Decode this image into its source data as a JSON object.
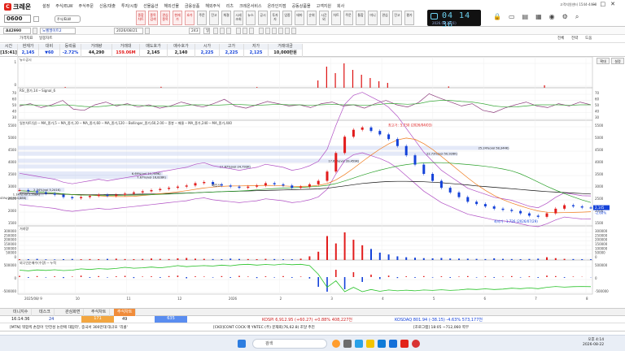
{
  "app": {
    "name": "크레온",
    "contact": "고객지원센터 1544-4488"
  },
  "menu": [
    "설정",
    "주식/ELW",
    "주식주문",
    "신용/대출",
    "투자/시황",
    "선물옵션",
    "해외선물",
    "금융상품",
    "해외주식",
    "리츠",
    "크레온서비스",
    "온라인지점",
    "공동상품몰",
    "고객지원",
    "회사"
  ],
  "toolbar_buttons": [
    "종합\n차트",
    "종목\n검색",
    "관심\n종목",
    "현재\n가",
    "호가",
    "주문",
    "잔고",
    "체결",
    "시세\n조회",
    "뉴스",
    "공시",
    "투자\n자",
    "업종",
    "테마",
    "순위",
    "시간\n외",
    "차트",
    "주문",
    "통합",
    "미니",
    "관심",
    "잔고",
    "평가"
  ],
  "clock": {
    "time": "04 14 36",
    "date": "2026.08.22(토)"
  },
  "stock": {
    "code": "0600",
    "code2": "A42990",
    "market_select": "주식/ELW",
    "name": "노벨엘이트2",
    "date": "2026/08/21",
    "count": "243",
    "period": "일",
    "chart_type": "일봉차트"
  },
  "tool3": {
    "tabs": [
      "가격지표",
      "일봉차트"
    ],
    "right": [
      "전체",
      "전략",
      "도움"
    ],
    "side": [
      "확대",
      "설정"
    ]
  },
  "pricehead": [
    {
      "label": "시간",
      "value": "[15:41]",
      "cls": ""
    },
    {
      "label": "현재가",
      "value": "2,145",
      "cls": "dn"
    },
    {
      "label": "대비",
      "value": "▼60",
      "cls": "dn"
    },
    {
      "label": "등락률",
      "value": "-2.72%",
      "cls": "dn"
    },
    {
      "label": "거래량",
      "value": "44,290",
      "cls": ""
    },
    {
      "label": "거래대",
      "value": "159.06M",
      "cls": "up"
    },
    {
      "label": "매도호가",
      "value": "2,145",
      "cls": ""
    },
    {
      "label": "매수호가",
      "value": "2,140",
      "cls": ""
    },
    {
      "label": "시가",
      "value": "2,225",
      "cls": "dn"
    },
    {
      "label": "고가",
      "value": "2,225",
      "cls": "dn"
    },
    {
      "label": "저가",
      "value": "2,125",
      "cls": "dn"
    },
    {
      "label": "거래대금",
      "value": "10,000만원",
      "cls": ""
    }
  ],
  "panels": {
    "p1": {
      "label": "뉴스공시",
      "yticks": [
        "1",
        "0"
      ]
    },
    "p2": {
      "label": "RSI_종가,14 ─ Signal_6",
      "yticks": [
        "70",
        "60",
        "50",
        "40",
        "30"
      ],
      "rticks": [
        "70",
        "60",
        "50",
        "40",
        "30"
      ]
    },
    "p3": {
      "label": "일봉차트(일) ─ MA_종가,5 ─ MA_종가,20 ─ MA_종가,60 ─ MA_종가,120 ─ Bollinger_종가,60,2.00 ─ 종봉 ─ 매물 ─ MA_종가,240 ─ MA_종가,480",
      "yticks": [
        "5500",
        "5000",
        "4500",
        "4000",
        "3500",
        "3000",
        "2500",
        "2000",
        "1500"
      ],
      "rticks": [
        "5500",
        "5000",
        "4500",
        "4000",
        "3500",
        "3000",
        "2500",
        "2000",
        "1500"
      ],
      "current": "2,145",
      "change": "-2.60%",
      "high_label": "최고가 : 5,730 (2026/04/03)",
      "low_label": "최저가 : 1,726 (2026/07/29)",
      "vp": [
        "25.24%(vol 58,344K)",
        "22.73%(vol 50,926K)",
        "17.61%(vol 39,459K)",
        "11.87%(vol 24,793K)",
        "6.69%(vol 14,769K)",
        "7.67%(vol 16,828K)",
        "2.34%(vol 5,241K)",
        "1.14%(vol 2,558K)",
        "0.43%(vol 954,886)"
      ],
      "annot": "매입선"
    },
    "p4": {
      "label": "거래량",
      "yticks": [
        "300000",
        "250000",
        "200000",
        "150000",
        "100000",
        "50000",
        "0"
      ],
      "rticks": [
        "300000",
        "250000",
        "200000",
        "150000",
        "100000",
        "50000",
        "0"
      ]
    },
    "p5": {
      "label": "외국인순매수(수량) ─ 누적",
      "yticks": [
        "500000",
        "0",
        "-500000"
      ],
      "rticks": [
        "500000",
        "0",
        "-500000"
      ]
    }
  },
  "xaxis": [
    "2025/08/ 9",
    "10",
    "11",
    "12",
    "2026",
    "2",
    "3",
    "4",
    "5",
    "6",
    "7",
    "8"
  ],
  "tabs": [
    "미니지수",
    "데스크",
    "관심화면",
    "주식차트",
    "주식차트"
  ],
  "ticker": {
    "time": "16:14:36",
    "c1": "24",
    "c2": "171",
    "c3": "49",
    "c4": "635",
    "kospi": "KOSPI 6,912.95 (+60.27) +0.88% 408,227천",
    "kosdaq": "KOSDAQ 801.94 (-38.15) -4.63% 573,177천"
  },
  "news": {
    "left": "[MTN] 뭐함씩 손잡아 '안전성 논란에 대답라', 중국서 300만대 대규모 '리콜'",
    "right": "[CKO]CONT COCK 매 YNTEC (주) 문재회(76,62.8) 조달 추진",
    "far": "[조로그램] 18:05 ~712,060 쪽부"
  },
  "taskbar": {
    "search": "검색",
    "time": "오후 4:14",
    "date": "2026-08-22"
  },
  "colors": {
    "up": "#e21c1c",
    "down": "#1442d9",
    "accent": "#f08c3a",
    "bg_upper": "#cdd7f3"
  },
  "chart_data": [
    {
      "type": "line",
      "title": "RSI",
      "series": [
        {
          "name": "RSI_종가,14",
          "values": [
            48,
            52,
            45,
            50,
            58,
            42,
            40,
            50,
            55,
            48,
            52,
            46,
            50,
            44,
            48,
            55,
            50,
            46,
            52,
            60,
            48,
            44,
            50,
            56,
            52,
            48,
            50,
            45,
            52,
            55,
            48,
            50,
            44,
            52,
            58,
            50,
            46,
            54,
            70,
            62,
            55,
            48,
            52,
            40,
            36,
            44,
            50,
            55,
            48,
            45,
            52,
            48,
            55,
            50
          ]
        },
        {
          "name": "Signal_6",
          "values": [
            50,
            50,
            49,
            48,
            50,
            49,
            47,
            46,
            48,
            50,
            50,
            49,
            48,
            48,
            47,
            48,
            50,
            50,
            49,
            50,
            51,
            50,
            49,
            50,
            51,
            50,
            50,
            49,
            50,
            51,
            50,
            50,
            49,
            50,
            52,
            52,
            51,
            52,
            56,
            58,
            58,
            56,
            55,
            52,
            48,
            46,
            46,
            48,
            50,
            50,
            50,
            49,
            50,
            50
          ]
        }
      ]
    },
    {
      "type": "line",
      "title": "주가",
      "ylim": [
        1500,
        5700
      ],
      "series": [
        {
          "name": "종가",
          "values": [
            2900,
            2850,
            2800,
            2750,
            2700,
            2600,
            2550,
            2600,
            2650,
            2700,
            2650,
            2700,
            2750,
            2800,
            2850,
            2900,
            2950,
            3000,
            3050,
            3100,
            3200,
            3250,
            3150,
            3100,
            3050,
            3000,
            3050,
            3100,
            3200,
            3150,
            3100,
            3000,
            3050,
            3150,
            3300,
            3700,
            4500,
            5200,
            5500,
            5600,
            5450,
            5300,
            5100,
            4800,
            4400,
            4000,
            3600,
            3300,
            3000,
            2800,
            2600,
            2400,
            2300,
            2200,
            2100,
            2050,
            2000,
            1900,
            1800,
            1750,
            1900,
            2100,
            2250,
            2200,
            2150,
            2145
          ]
        },
        {
          "name": "MA_종가,120",
          "values": [
            2800,
            2790,
            2780,
            2770,
            2760,
            2750,
            2740,
            2735,
            2730,
            2730,
            2735,
            2740,
            2745,
            2750,
            2755,
            2760,
            2770,
            2780,
            2790,
            2800,
            2815,
            2830,
            2845,
            2860,
            2870,
            2880,
            2890,
            2900,
            2910,
            2920,
            2930,
            2940,
            2950,
            2960,
            2975,
            3000,
            3050,
            3100,
            3150,
            3200,
            3230,
            3260,
            3280,
            3290,
            3290,
            3280,
            3270,
            3250,
            3230,
            3200,
            3170,
            3140,
            3100,
            3070,
            3040,
            3010,
            2980,
            2950,
            2920,
            2890,
            2860,
            2840,
            2820,
            2800,
            2780,
            2760
          ]
        }
      ]
    },
    {
      "type": "bar",
      "title": "거래량",
      "values": [
        8000,
        9000,
        12000,
        7000,
        6000,
        9000,
        11000,
        8000,
        10000,
        9000,
        12000,
        14000,
        10000,
        9000,
        11000,
        16000,
        12000,
        10000,
        18000,
        22000,
        14000,
        12000,
        10000,
        9000,
        15000,
        11000,
        10000,
        9000,
        12000,
        10000,
        8000,
        9000,
        14000,
        40000,
        90000,
        260000,
        180000,
        300000,
        220000,
        160000,
        120000,
        80000,
        60000,
        40000,
        30000,
        25000,
        20000,
        18000,
        22000,
        16000,
        15000,
        14000,
        12000,
        10000,
        18000,
        12000,
        10000,
        9000,
        11000,
        14000,
        30000,
        20000,
        12000,
        10000,
        9000,
        8000
      ]
    },
    {
      "type": "bar",
      "title": "외국인순매수",
      "values": [
        50000,
        -30000,
        40000,
        -20000,
        30000,
        -40000,
        20000,
        60000,
        -30000,
        40000,
        -20000,
        30000,
        50000,
        -40000,
        20000,
        30000,
        -30000,
        40000,
        60000,
        -50000,
        30000,
        20000,
        -20000,
        40000,
        -30000,
        50000,
        20000,
        -40000,
        30000,
        -20000,
        40000,
        -30000,
        20000,
        -60000,
        -400000,
        -600000,
        300000,
        -500000,
        200000,
        -200000,
        100000,
        -80000,
        60000,
        -40000,
        30000,
        -30000,
        40000,
        -20000,
        30000,
        -30000,
        20000,
        40000,
        -20000,
        30000,
        -30000,
        20000,
        40000,
        -20000,
        30000,
        -30000,
        60000,
        40000,
        -30000,
        20000,
        10000,
        -10000
      ]
    }
  ]
}
